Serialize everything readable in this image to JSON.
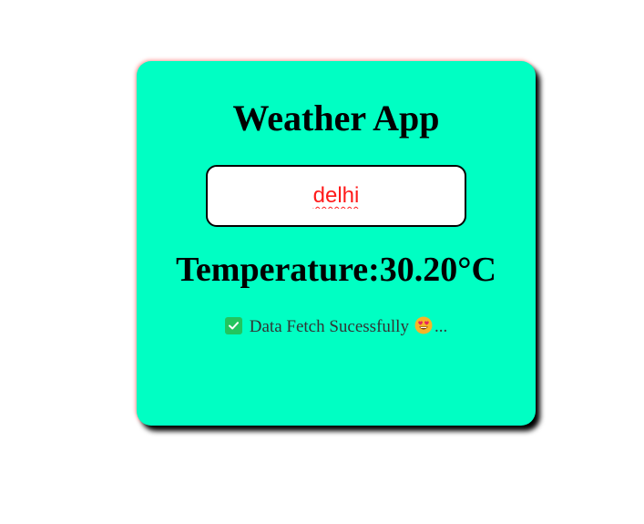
{
  "app": {
    "title": "Weather App"
  },
  "search": {
    "value": "delhi"
  },
  "weather": {
    "temperature_text": "Temperature:30.20°C"
  },
  "status": {
    "icon": "check-icon",
    "message": "Data Fetch Sucessfully",
    "emoji": "heart-eyes-emoji-icon",
    "suffix": "..."
  },
  "colors": {
    "card_background": "#00ffc3",
    "input_text": "#ff1a1a",
    "check_green": "#22c55e"
  }
}
